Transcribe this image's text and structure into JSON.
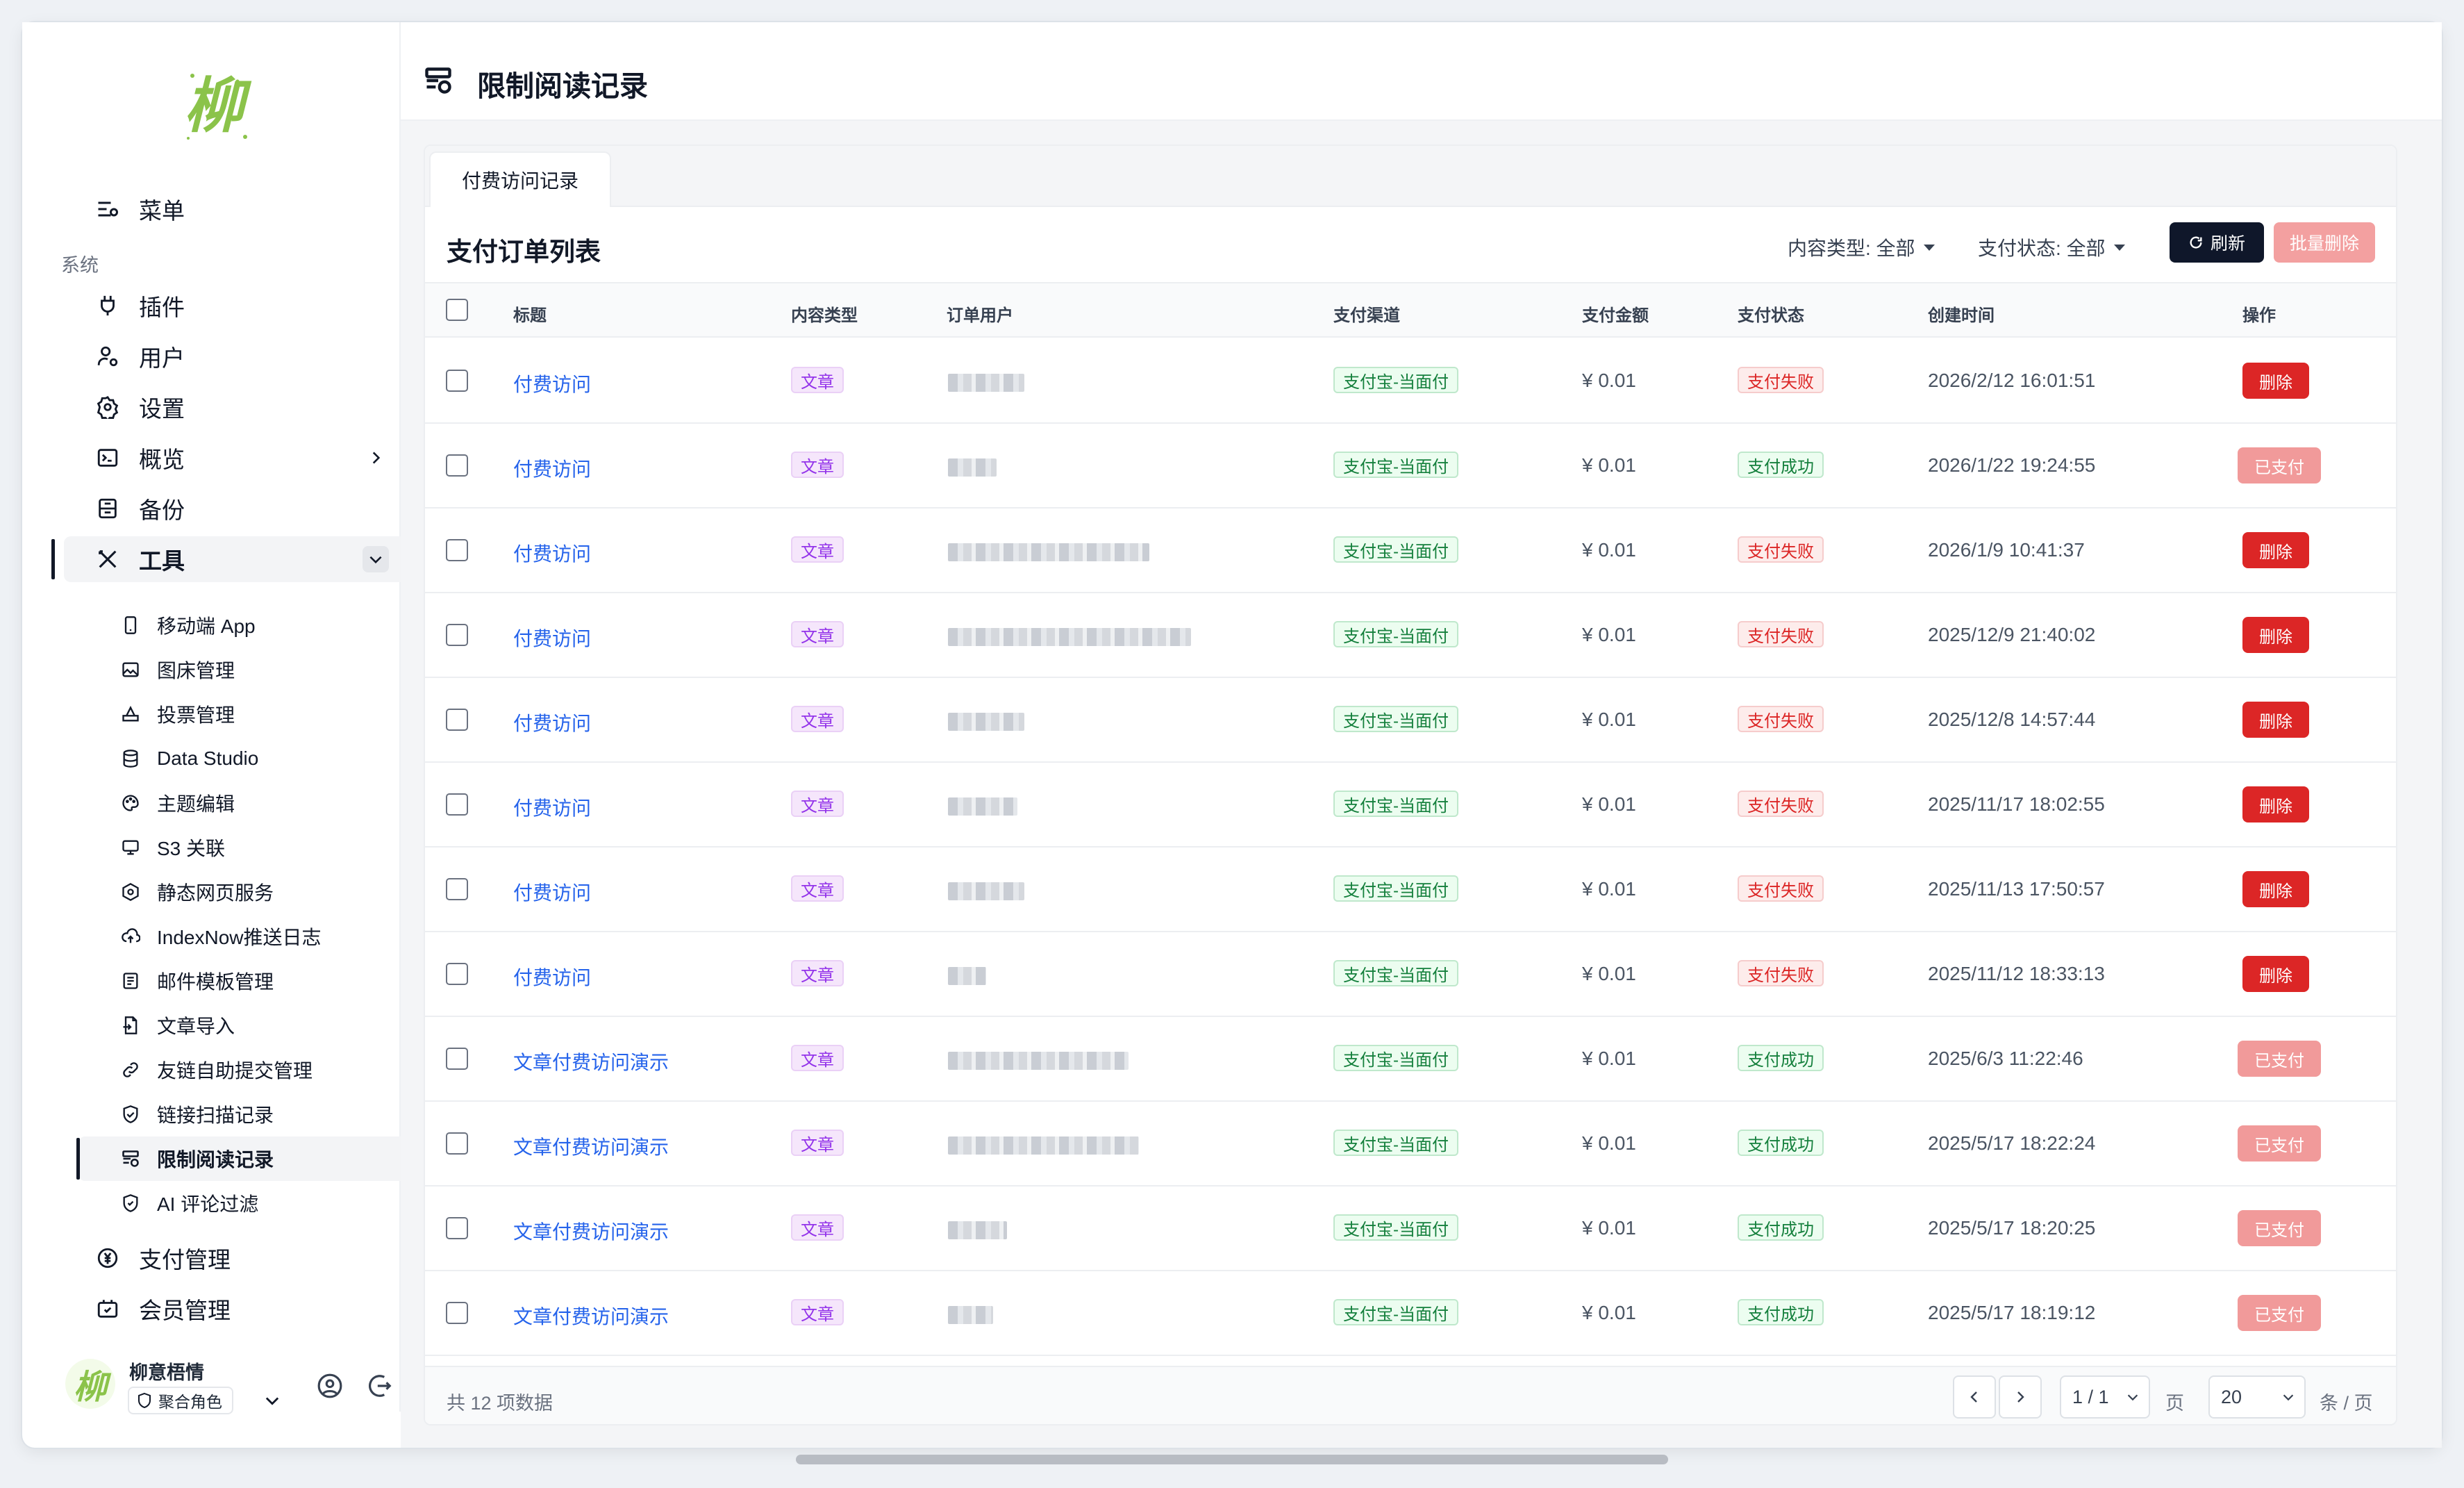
{
  "app": {
    "logo_text": "柳"
  },
  "sidebar": {
    "menu_label": "菜单",
    "group_label": "系统",
    "items": [
      {
        "label": "插件"
      },
      {
        "label": "用户"
      },
      {
        "label": "设置"
      },
      {
        "label": "概览"
      },
      {
        "label": "备份"
      },
      {
        "label": "工具"
      },
      {
        "label": "支付管理"
      },
      {
        "label": "会员管理"
      }
    ],
    "tools_children": [
      {
        "label": "移动端 App"
      },
      {
        "label": "图床管理"
      },
      {
        "label": "投票管理"
      },
      {
        "label": "Data Studio"
      },
      {
        "label": "主题编辑"
      },
      {
        "label": "S3 关联"
      },
      {
        "label": "静态网页服务"
      },
      {
        "label": "IndexNow推送日志"
      },
      {
        "label": "邮件模板管理"
      },
      {
        "label": "文章导入"
      },
      {
        "label": "友链自助提交管理"
      },
      {
        "label": "链接扫描记录"
      },
      {
        "label": "限制阅读记录"
      },
      {
        "label": "AI 评论过滤"
      }
    ],
    "user": {
      "name": "柳意梧情",
      "role": "聚合角色",
      "avatar_text": "柳"
    }
  },
  "header": {
    "title": "限制阅读记录"
  },
  "tabs": [
    {
      "label": "付费访问记录"
    }
  ],
  "list": {
    "title": "支付订单列表",
    "filter_content_type": "内容类型: 全部",
    "filter_pay_status": "支付状态: 全部",
    "refresh_label": "刷新",
    "batch_delete_label": "批量删除",
    "columns": [
      "标题",
      "内容类型",
      "订单用户",
      "支付渠道",
      "支付金额",
      "支付状态",
      "创建时间",
      "操作"
    ],
    "rows": [
      {
        "title": "付费访问",
        "type": "文章",
        "channel": "支付宝-当面付",
        "amount": "¥ 0.01",
        "status": "支付失败",
        "status_kind": "fail",
        "time": "2026/2/12 16:01:51",
        "action": "删除",
        "action_kind": "delete"
      },
      {
        "title": "付费访问",
        "type": "文章",
        "channel": "支付宝-当面付",
        "amount": "¥ 0.01",
        "status": "支付成功",
        "status_kind": "success",
        "time": "2026/1/22 19:24:55",
        "action": "已支付",
        "action_kind": "paid"
      },
      {
        "title": "付费访问",
        "type": "文章",
        "channel": "支付宝-当面付",
        "amount": "¥ 0.01",
        "status": "支付失败",
        "status_kind": "fail",
        "time": "2026/1/9 10:41:37",
        "action": "删除",
        "action_kind": "delete"
      },
      {
        "title": "付费访问",
        "type": "文章",
        "channel": "支付宝-当面付",
        "amount": "¥ 0.01",
        "status": "支付失败",
        "status_kind": "fail",
        "time": "2025/12/9 21:40:02",
        "action": "删除",
        "action_kind": "delete"
      },
      {
        "title": "付费访问",
        "type": "文章",
        "channel": "支付宝-当面付",
        "amount": "¥ 0.01",
        "status": "支付失败",
        "status_kind": "fail",
        "time": "2025/12/8 14:57:44",
        "action": "删除",
        "action_kind": "delete"
      },
      {
        "title": "付费访问",
        "type": "文章",
        "channel": "支付宝-当面付",
        "amount": "¥ 0.01",
        "status": "支付失败",
        "status_kind": "fail",
        "time": "2025/11/17 18:02:55",
        "action": "删除",
        "action_kind": "delete"
      },
      {
        "title": "付费访问",
        "type": "文章",
        "channel": "支付宝-当面付",
        "amount": "¥ 0.01",
        "status": "支付失败",
        "status_kind": "fail",
        "time": "2025/11/13 17:50:57",
        "action": "删除",
        "action_kind": "delete"
      },
      {
        "title": "付费访问",
        "type": "文章",
        "channel": "支付宝-当面付",
        "amount": "¥ 0.01",
        "status": "支付失败",
        "status_kind": "fail",
        "time": "2025/11/12 18:33:13",
        "action": "删除",
        "action_kind": "delete"
      },
      {
        "title": "文章付费访问演示",
        "type": "文章",
        "channel": "支付宝-当面付",
        "amount": "¥ 0.01",
        "status": "支付成功",
        "status_kind": "success",
        "time": "2025/6/3 11:22:46",
        "action": "已支付",
        "action_kind": "paid"
      },
      {
        "title": "文章付费访问演示",
        "type": "文章",
        "channel": "支付宝-当面付",
        "amount": "¥ 0.01",
        "status": "支付成功",
        "status_kind": "success",
        "time": "2025/5/17 18:22:24",
        "action": "已支付",
        "action_kind": "paid"
      },
      {
        "title": "文章付费访问演示",
        "type": "文章",
        "channel": "支付宝-当面付",
        "amount": "¥ 0.01",
        "status": "支付成功",
        "status_kind": "success",
        "time": "2025/5/17 18:20:25",
        "action": "已支付",
        "action_kind": "paid"
      },
      {
        "title": "文章付费访问演示",
        "type": "文章",
        "channel": "支付宝-当面付",
        "amount": "¥ 0.01",
        "status": "支付成功",
        "status_kind": "success",
        "time": "2025/5/17 18:19:12",
        "action": "已支付",
        "action_kind": "paid"
      }
    ],
    "footer": {
      "total": "共 12 项数据",
      "page": "1 / 1",
      "page_unit": "页",
      "page_size": "20",
      "size_unit": "条 / 页"
    }
  },
  "colors": {
    "accent": "#0f172a",
    "link": "#2563eb",
    "danger": "#dc2626",
    "danger_light": "#f19a9a",
    "success": "#15803d"
  }
}
